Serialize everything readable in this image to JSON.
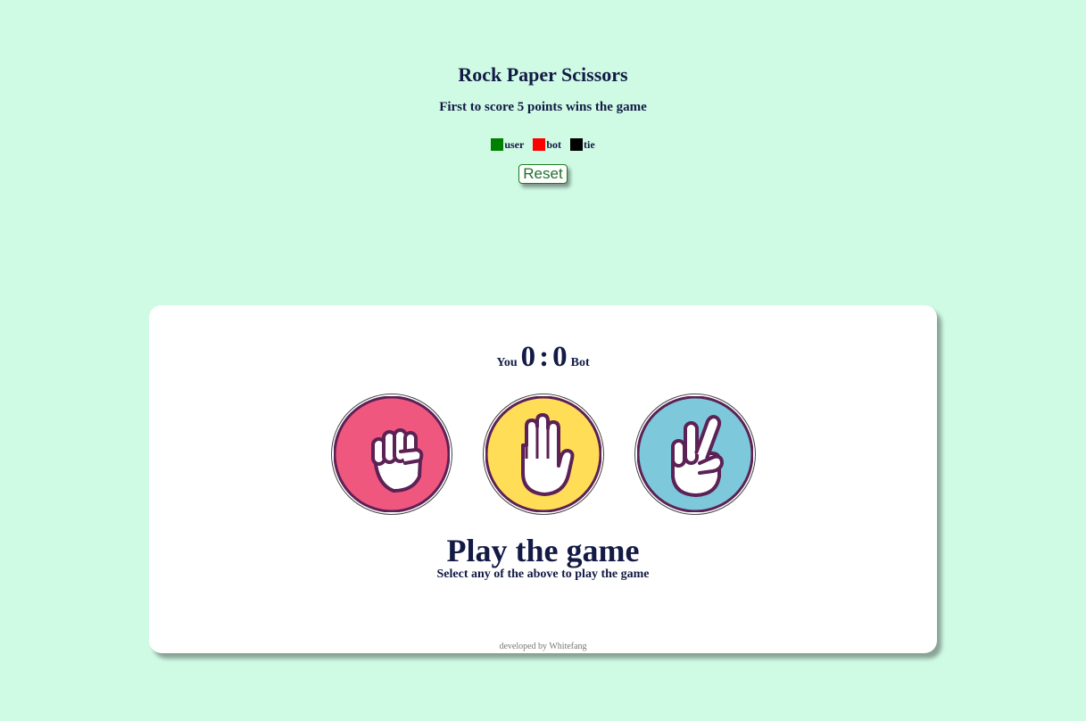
{
  "header": {
    "title": "Rock Paper Scissors",
    "subtitle": "First to score 5 points wins the game",
    "reset_label": "Reset"
  },
  "legend": [
    {
      "label": "user",
      "color": "#008000"
    },
    {
      "label": "bot",
      "color": "#ff0000"
    },
    {
      "label": "tie",
      "color": "#000000"
    }
  ],
  "scoreboard": {
    "you_label": "You",
    "user_score": "0",
    "separator": ":",
    "bot_score": "0",
    "bot_label": "Bot"
  },
  "choices": [
    {
      "name": "rock",
      "icon": "rock-fist-icon",
      "color": "#f0577f"
    },
    {
      "name": "paper",
      "icon": "paper-hand-icon",
      "color": "#ffdd57"
    },
    {
      "name": "scissors",
      "icon": "scissors-hand-icon",
      "color": "#7ec8db"
    }
  ],
  "status": {
    "title": "Play the game",
    "subtitle": "Select any of the above to play the game"
  },
  "footer": {
    "credit": "developed by Whitefang"
  }
}
